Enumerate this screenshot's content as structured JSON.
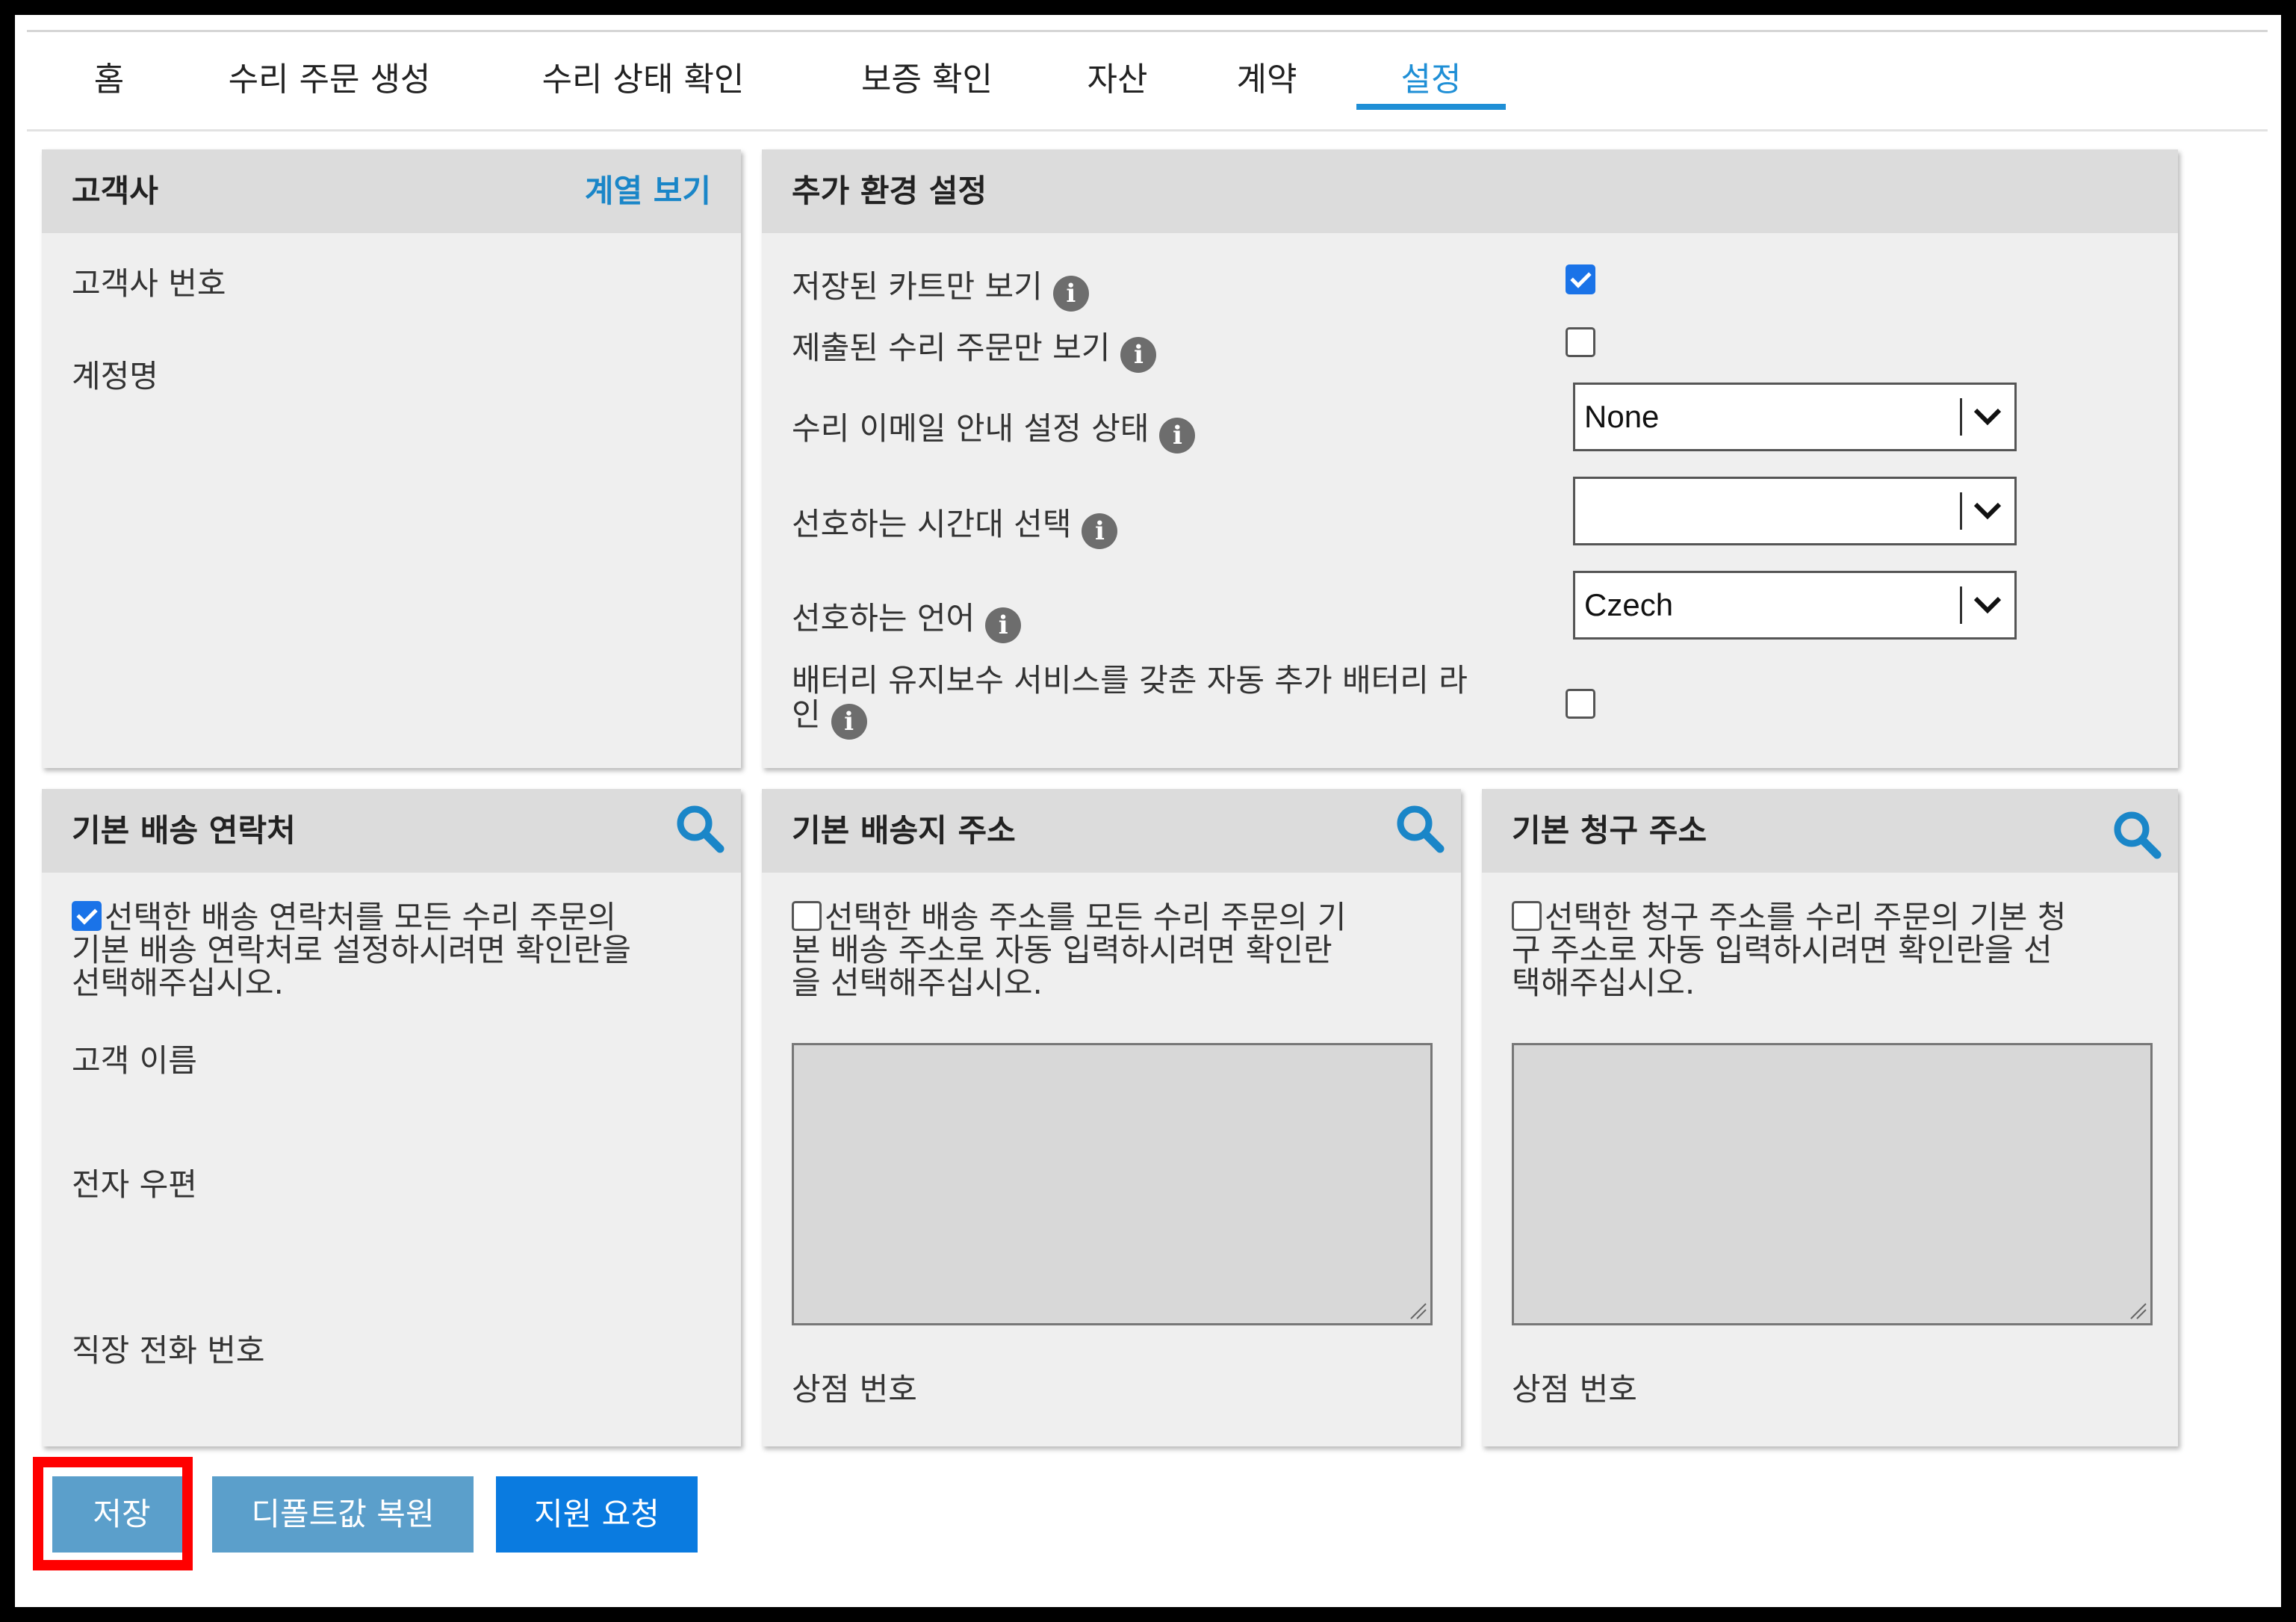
{
  "tabs": [
    {
      "label": "홈"
    },
    {
      "label": "수리 주문 생성"
    },
    {
      "label": "수리 상태 확인"
    },
    {
      "label": "보증 확인"
    },
    {
      "label": "자산"
    },
    {
      "label": "계약"
    },
    {
      "label": "설정"
    }
  ],
  "active_tab": "설정",
  "customer": {
    "title": "고객사",
    "link": "계열 보기",
    "fields": [
      "고객사 번호",
      "계정명"
    ]
  },
  "settings": {
    "title": "추가 환경 설정",
    "rows": [
      {
        "label": "저장된 카트만 보기",
        "type": "checkbox",
        "checked": true
      },
      {
        "label": "제출된 수리 주문만 보기",
        "type": "checkbox",
        "checked": false
      },
      {
        "label": "수리 이메일 안내 설정 상태",
        "type": "select",
        "value": "None"
      },
      {
        "label": "선호하는 시간대 선택",
        "type": "select",
        "value": ""
      },
      {
        "label": "선호하는 언어",
        "type": "select",
        "value": "Czech"
      },
      {
        "label_line1": "배터리 유지보수 서비스를 갖춘 자동 추가 배터리 라",
        "label_line2": "인",
        "type": "checkbox",
        "checked": false
      }
    ]
  },
  "shipping_contact": {
    "title": "기본 배송 연락처",
    "checked": true,
    "desc_lines": [
      "선택한 배송 연락처를 모든 수리 주문의",
      "기본 배송 연락처로 설정하시려면 확인란을",
      "선택해주십시오."
    ],
    "fields": [
      "고객 이름",
      "전자 우편",
      "직장 전화 번호"
    ]
  },
  "shipping_address": {
    "title": "기본 배송지 주소",
    "checked": false,
    "desc_lines": [
      "선택한 배송 주소를 모든 수리 주문의 기",
      "본 배송 주소로 자동 입력하시려면 확인란",
      "을 선택해주십시오."
    ],
    "store_label": "상점 번호"
  },
  "billing_address": {
    "title": "기본 청구 주소",
    "checked": false,
    "desc_lines": [
      "선택한 청구 주소를 수리 주문의 기본 청",
      "구 주소로 자동 입력하시려면 확인란을 선",
      "택해주십시오."
    ],
    "store_label": "상점 번호"
  },
  "buttons": {
    "save": "저장",
    "restore": "디폴트값 복원",
    "support": "지원 요청"
  },
  "colors": {
    "accent": "#1f8fd6",
    "save_button": "#5b9fcb",
    "support_button": "#0a7be0",
    "highlight": "#ff0000"
  }
}
